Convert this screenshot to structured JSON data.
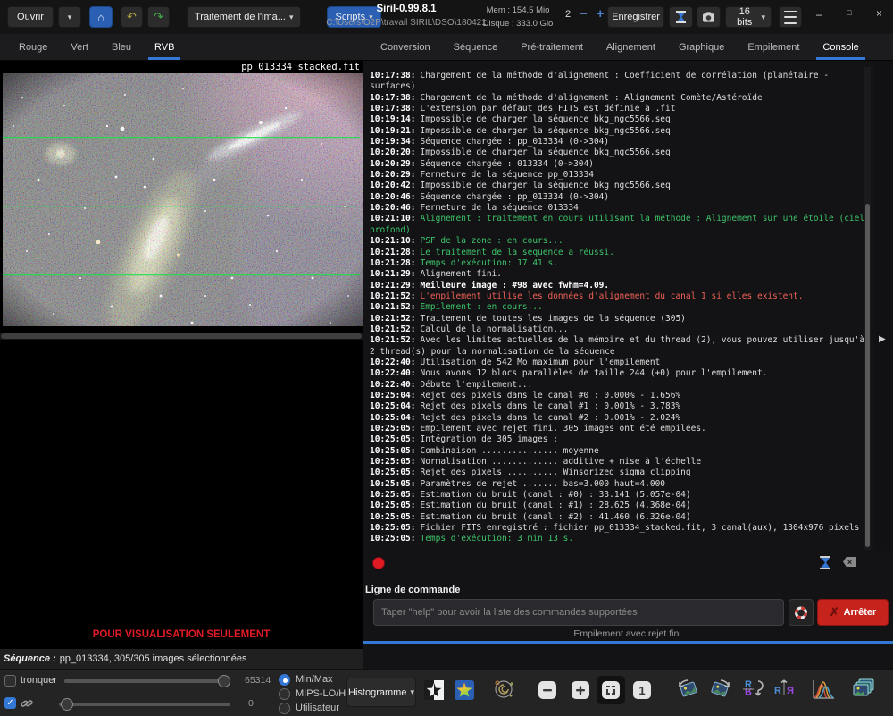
{
  "header": {
    "open_label": "Ouvrir",
    "processing_menu_label": "Traitement de l'ima...",
    "scripts_label": "Scripts",
    "title": "Siril-0.99.8.1",
    "path": "C:\\Users\\O2P\\travail SIRIL\\DSO\\180421",
    "mem_label": "Mem : 154.5 Mio",
    "disk_label": "Disque : 333.0 Gio",
    "threads_value": "2",
    "save_label": "Enregistrer",
    "bitdepth_label": "16 bits"
  },
  "icons": {
    "caret": "▾",
    "home": "⌂",
    "undo": "↶",
    "redo": "↷",
    "minus": "−",
    "plus": "+",
    "win_min": "–",
    "win_max": "□",
    "win_close": "×",
    "expander": "▶",
    "stop_x": "✗",
    "clear_x": "×",
    "zoom_out": "−",
    "zoom_in": "+",
    "zoom_one": "1"
  },
  "left_tabs": [
    "Rouge",
    "Vert",
    "Bleu",
    "RVB"
  ],
  "left_tabs_selected": "RVB",
  "image_view": {
    "filename": "pp_013334_stacked.fit",
    "watermark": "POUR VISUALISATION SEULEMENT"
  },
  "sequence_bar": {
    "label": "Séquence :",
    "info": "pp_013334, 305/305 images sélectionnées"
  },
  "display_controls": {
    "truncate_label": "tronquer",
    "high_value": "65314",
    "low_value": "0",
    "mode_minmax": "Min/Max",
    "mode_mips": "MIPS-LO/HI",
    "mode_user": "Utilisateur",
    "selected_mode": "Min/Max",
    "histogram_label": "Histogramme"
  },
  "right_tabs": [
    "Conversion",
    "Séquence",
    "Pré-traitement",
    "Alignement",
    "Graphique",
    "Empilement",
    "Console"
  ],
  "right_tabs_selected": "Console",
  "console": {
    "lines": [
      {
        "t": "10:17:38:",
        "m": "Chargement de la méthode d'alignement : Coefficient de corrélation (planétaire - surfaces)",
        "c": ""
      },
      {
        "t": "10:17:38:",
        "m": "Chargement de la méthode d'alignement : Alignement Comète/Astéroïde",
        "c": ""
      },
      {
        "t": "10:17:38:",
        "m": "L'extension par défaut des FITS est définie à .fit",
        "c": ""
      },
      {
        "t": "10:19:14:",
        "m": "Impossible de charger la séquence bkg_ngc5566.seq",
        "c": ""
      },
      {
        "t": "10:19:21:",
        "m": "Impossible de charger la séquence bkg_ngc5566.seq",
        "c": ""
      },
      {
        "t": "10:19:34:",
        "m": "Séquence chargée : pp_013334 (0->304)",
        "c": ""
      },
      {
        "t": "10:20:20:",
        "m": "Impossible de charger la séquence bkg_ngc5566.seq",
        "c": ""
      },
      {
        "t": "10:20:29:",
        "m": "Séquence chargée : 013334 (0->304)",
        "c": ""
      },
      {
        "t": "10:20:29:",
        "m": "Fermeture de la séquence pp_013334",
        "c": ""
      },
      {
        "t": "10:20:42:",
        "m": "Impossible de charger la séquence bkg_ngc5566.seq",
        "c": ""
      },
      {
        "t": "10:20:46:",
        "m": "Séquence chargée : pp_013334 (0->304)",
        "c": ""
      },
      {
        "t": "10:20:46:",
        "m": "Fermeture de la séquence 013334",
        "c": ""
      },
      {
        "t": "10:21:10:",
        "m": "Alignement : traitement en cours utilisant la méthode : Alignement sur une étoile (ciel profond)",
        "c": "g"
      },
      {
        "t": "10:21:10:",
        "m": "PSF de la zone : en cours...",
        "c": "g"
      },
      {
        "t": "10:21:28:",
        "m": "Le traitement de la séquence a réussi.",
        "c": "g"
      },
      {
        "t": "10:21:28:",
        "m": "Temps d'exécution: 17.41 s.",
        "c": "g"
      },
      {
        "t": "10:21:29:",
        "m": "Alignement fini.",
        "c": ""
      },
      {
        "t": "10:21:29:",
        "m": "Meilleure image : #98 avec fwhm=4.09.",
        "c": "b"
      },
      {
        "t": "10:21:52:",
        "m": "L'empilement utilise les données d'alignement du canal 1 si elles existent.",
        "c": "r"
      },
      {
        "t": "10:21:52:",
        "m": "Empilement : en cours...",
        "c": "g"
      },
      {
        "t": "10:21:52:",
        "m": "Traitement de toutes les images de la séquence (305)",
        "c": ""
      },
      {
        "t": "10:21:52:",
        "m": "Calcul de la normalisation...",
        "c": ""
      },
      {
        "t": "10:21:52:",
        "m": "Avec les limites actuelles de la mémoire et du thread (2), vous pouvez utiliser jusqu'à 2 thread(s) pour la normalisation de la séquence",
        "c": ""
      },
      {
        "t": "10:22:40:",
        "m": "Utilisation de 542 Mo maximum pour l'empilement",
        "c": ""
      },
      {
        "t": "10:22:40:",
        "m": "Nous avons 12 blocs parallèles de taille 244 (+0) pour l'empilement.",
        "c": ""
      },
      {
        "t": "10:22:40:",
        "m": "Débute l'empilement...",
        "c": ""
      },
      {
        "t": "10:25:04:",
        "m": "Rejet des pixels dans le canal #0 : 0.000% - 1.656%",
        "c": ""
      },
      {
        "t": "10:25:04:",
        "m": "Rejet des pixels dans le canal #1 : 0.001% - 3.783%",
        "c": ""
      },
      {
        "t": "10:25:04:",
        "m": "Rejet des pixels dans le canal #2 : 0.001% - 2.024%",
        "c": ""
      },
      {
        "t": "10:25:05:",
        "m": "Empilement avec rejet fini. 305 images ont été empilées.",
        "c": ""
      },
      {
        "t": "10:25:05:",
        "m": "Intégration de 305 images :",
        "c": ""
      },
      {
        "t": "10:25:05:",
        "m": "Combinaison ............... moyenne",
        "c": ""
      },
      {
        "t": "10:25:05:",
        "m": "Normalisation ............. additive + mise à l'échelle",
        "c": ""
      },
      {
        "t": "10:25:05:",
        "m": "Rejet des pixels .......... Winsorized sigma clipping",
        "c": ""
      },
      {
        "t": "10:25:05:",
        "m": "Paramètres de rejet ....... bas=3.000 haut=4.000",
        "c": ""
      },
      {
        "t": "10:25:05:",
        "m": "Estimation du bruit (canal : #0) : 33.141 (5.057e-04)",
        "c": ""
      },
      {
        "t": "10:25:05:",
        "m": "Estimation du bruit (canal : #1) : 28.625 (4.368e-04)",
        "c": ""
      },
      {
        "t": "10:25:05:",
        "m": "Estimation du bruit (canal : #2) : 41.460 (6.326e-04)",
        "c": ""
      },
      {
        "t": "10:25:05:",
        "m": "Fichier FITS enregistré : fichier pp_013334_stacked.fit, 3 canal(aux), 1304x976 pixels",
        "c": ""
      },
      {
        "t": "10:25:05:",
        "m": "Temps d'exécution: 3 min 13 s.",
        "c": "g"
      }
    ]
  },
  "command": {
    "label": "Ligne de commande",
    "placeholder": "Taper \"help\" pour avoir la liste des commandes supportées",
    "stop_label": "Arrêter",
    "status": "Empilement avec rejet fini."
  },
  "colors": {
    "accent_blue": "#3577d4",
    "console_green": "#3dc46a",
    "console_red": "#ef6056",
    "watermark_red": "#e01b24",
    "stop_button_red": "#c7231d"
  }
}
